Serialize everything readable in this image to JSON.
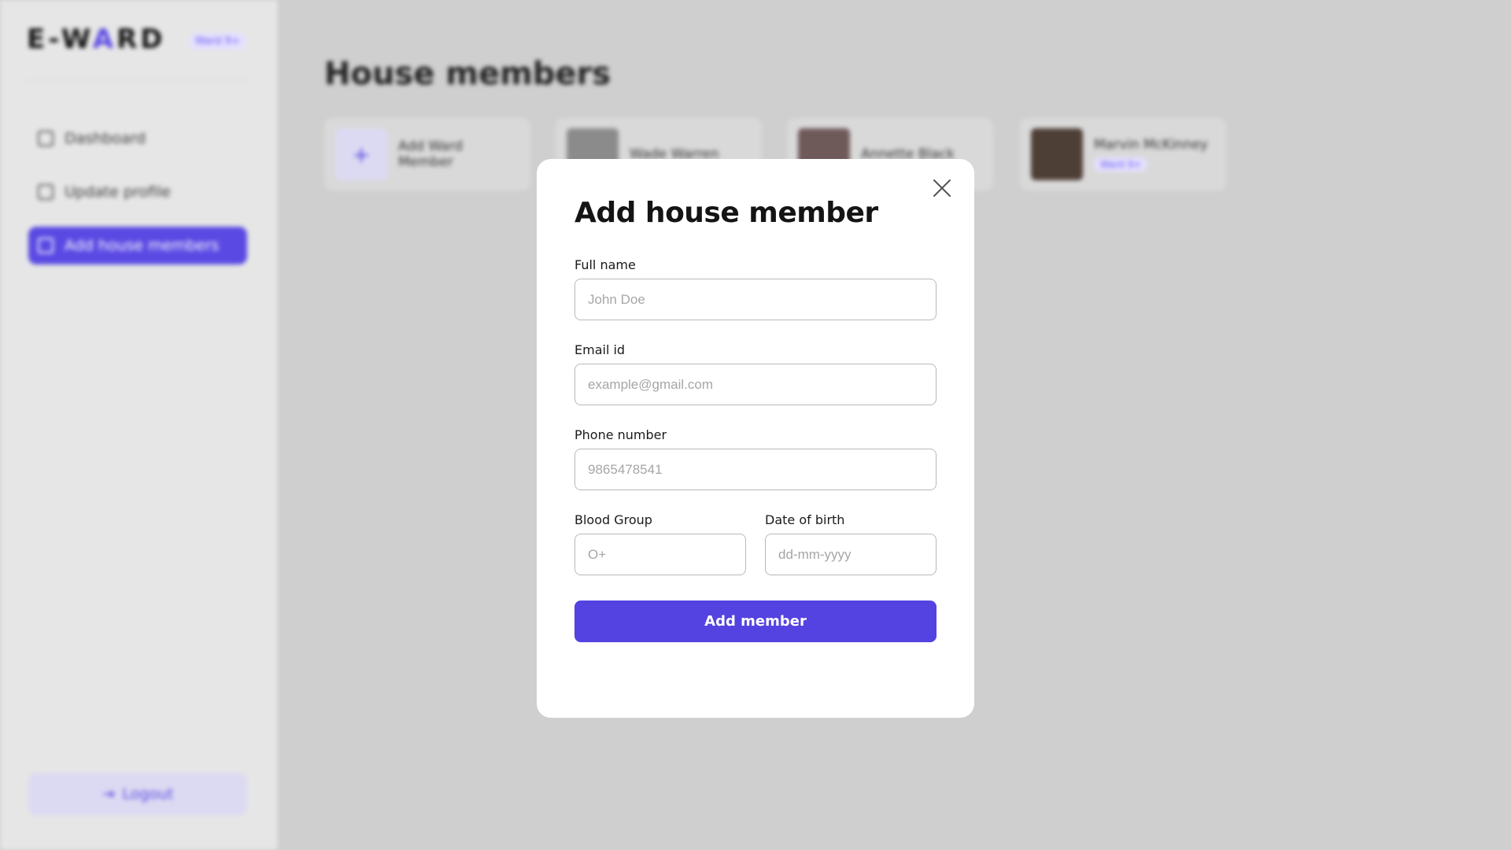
{
  "sidebar": {
    "logo_prefix": "E-W",
    "logo_accent": "A",
    "logo_suffix": "RD",
    "ward_label": "Ward 9+",
    "items": [
      {
        "label": "Dashboard",
        "icon": "grid-icon"
      },
      {
        "label": "Update profile",
        "icon": "edit-icon"
      },
      {
        "label": "Add house members",
        "icon": "user-add-icon"
      }
    ],
    "logout_label": "Logout"
  },
  "main": {
    "title": "House members",
    "add_card_label": "Add Ward Member",
    "members": [
      {
        "name": "Wade Warren",
        "tag": ""
      },
      {
        "name": "Annette Black",
        "tag": ""
      },
      {
        "name": "Marvin McKinney",
        "tag": "Ward 9+"
      }
    ]
  },
  "modal": {
    "title": "Add house member",
    "full_name": {
      "label": "Full name",
      "placeholder": "John Doe",
      "value": ""
    },
    "email": {
      "label": "Email id",
      "placeholder": "example@gmail.com",
      "value": ""
    },
    "phone": {
      "label": "Phone number",
      "placeholder": "9865478541",
      "value": ""
    },
    "blood_group": {
      "label": "Blood Group",
      "placeholder": "O+",
      "value": ""
    },
    "dob": {
      "label": "Date of birth",
      "placeholder": "dd-mm-yyyy",
      "value": ""
    },
    "submit_label": "Add member"
  },
  "colors": {
    "accent": "#5443e0",
    "overlay": "#cfcfcf",
    "modal_bg": "#ffffff"
  }
}
